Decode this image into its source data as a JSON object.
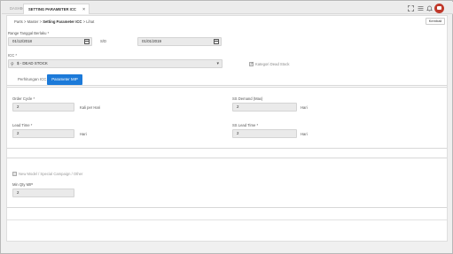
{
  "tabs": [
    {
      "label": "DASHBOARD"
    },
    {
      "label": "SETTING PARAMETER ICC"
    }
  ],
  "tab_close": "×",
  "toolbar_icons": [
    "expand-icon",
    "list-icon",
    "bell-icon",
    "avatar"
  ],
  "breadcrumb": {
    "items": [
      "Parts",
      ">",
      "Master",
      ">",
      "Setting Parameter ICC",
      ">",
      "Lihat"
    ]
  },
  "kembali_label": "Kembali",
  "range": {
    "label": "Range Tanggal Berlaku *",
    "from": "01/12/2018",
    "separator": "S/D",
    "to": "01/01/2019"
  },
  "icc": {
    "label": "ICC *",
    "value": "$ - DEAD STOCK",
    "search_glyph": "⚲",
    "caret": "▾"
  },
  "kategori_dead_stock": {
    "label": "Kategori Dead Stock",
    "checked": true
  },
  "subtabs": {
    "perhitungan": "Perhitungan ICC",
    "parameter": "Parameter MIP"
  },
  "fields": {
    "order_cycle": {
      "label": "Order Cycle *",
      "value": "2",
      "unit": "Kali per Hari"
    },
    "ss_demand": {
      "label": "SS Demand (Max)",
      "value": "2",
      "unit": "Hari"
    },
    "lead_time": {
      "label": "Lead Time *",
      "value": "2",
      "unit": "Hari"
    },
    "ss_lead_time": {
      "label": "SS Lead Time *",
      "value": "2",
      "unit": "Hari"
    }
  },
  "new_model": {
    "label": "New Model / Special Campaign / Other",
    "checked": false
  },
  "min_qty_mip": {
    "label": "Min Qty MIP",
    "value": "2"
  },
  "colors": {
    "accent": "#1c7ad9",
    "avatar": "#c0392b",
    "input_bg": "#eaeaea"
  }
}
